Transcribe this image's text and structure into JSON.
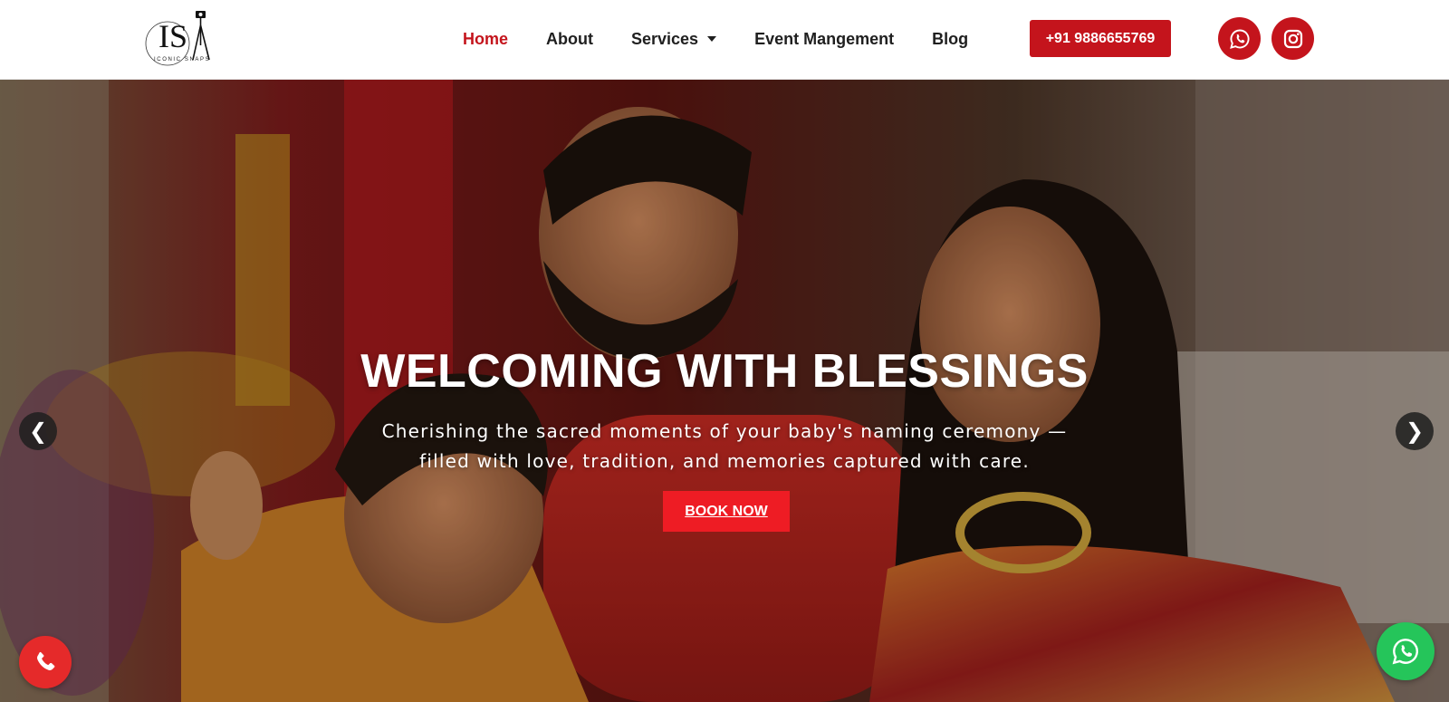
{
  "brand": {
    "logo_letters": "IS",
    "logo_tagline": "ICONIC SNAPS",
    "accent_color": "#c4141c"
  },
  "nav": {
    "items": [
      {
        "label": "Home",
        "active": true
      },
      {
        "label": "About"
      },
      {
        "label": "Services",
        "has_dropdown": true
      },
      {
        "label": "Event Mangement"
      },
      {
        "label": "Blog"
      }
    ],
    "phone_label": "+91 9886655769",
    "social_icons": [
      "whatsapp-icon",
      "instagram-icon"
    ]
  },
  "hero": {
    "title": "WELCOMING WITH BLESSINGS",
    "subtitle_line1": "Cherishing the sacred moments of your baby's naming ceremony —",
    "subtitle_line2": "filled with love, tradition, and memories captured with care.",
    "cta_label": "BOOK NOW",
    "prev_arrow": "❮",
    "next_arrow": "❯",
    "cta_color": "#ee1c24"
  },
  "floating": {
    "call_icon": "phone-icon",
    "call_color": "#e52a2a",
    "whatsapp_icon": "whatsapp-icon",
    "whatsapp_color": "#25c55a"
  }
}
